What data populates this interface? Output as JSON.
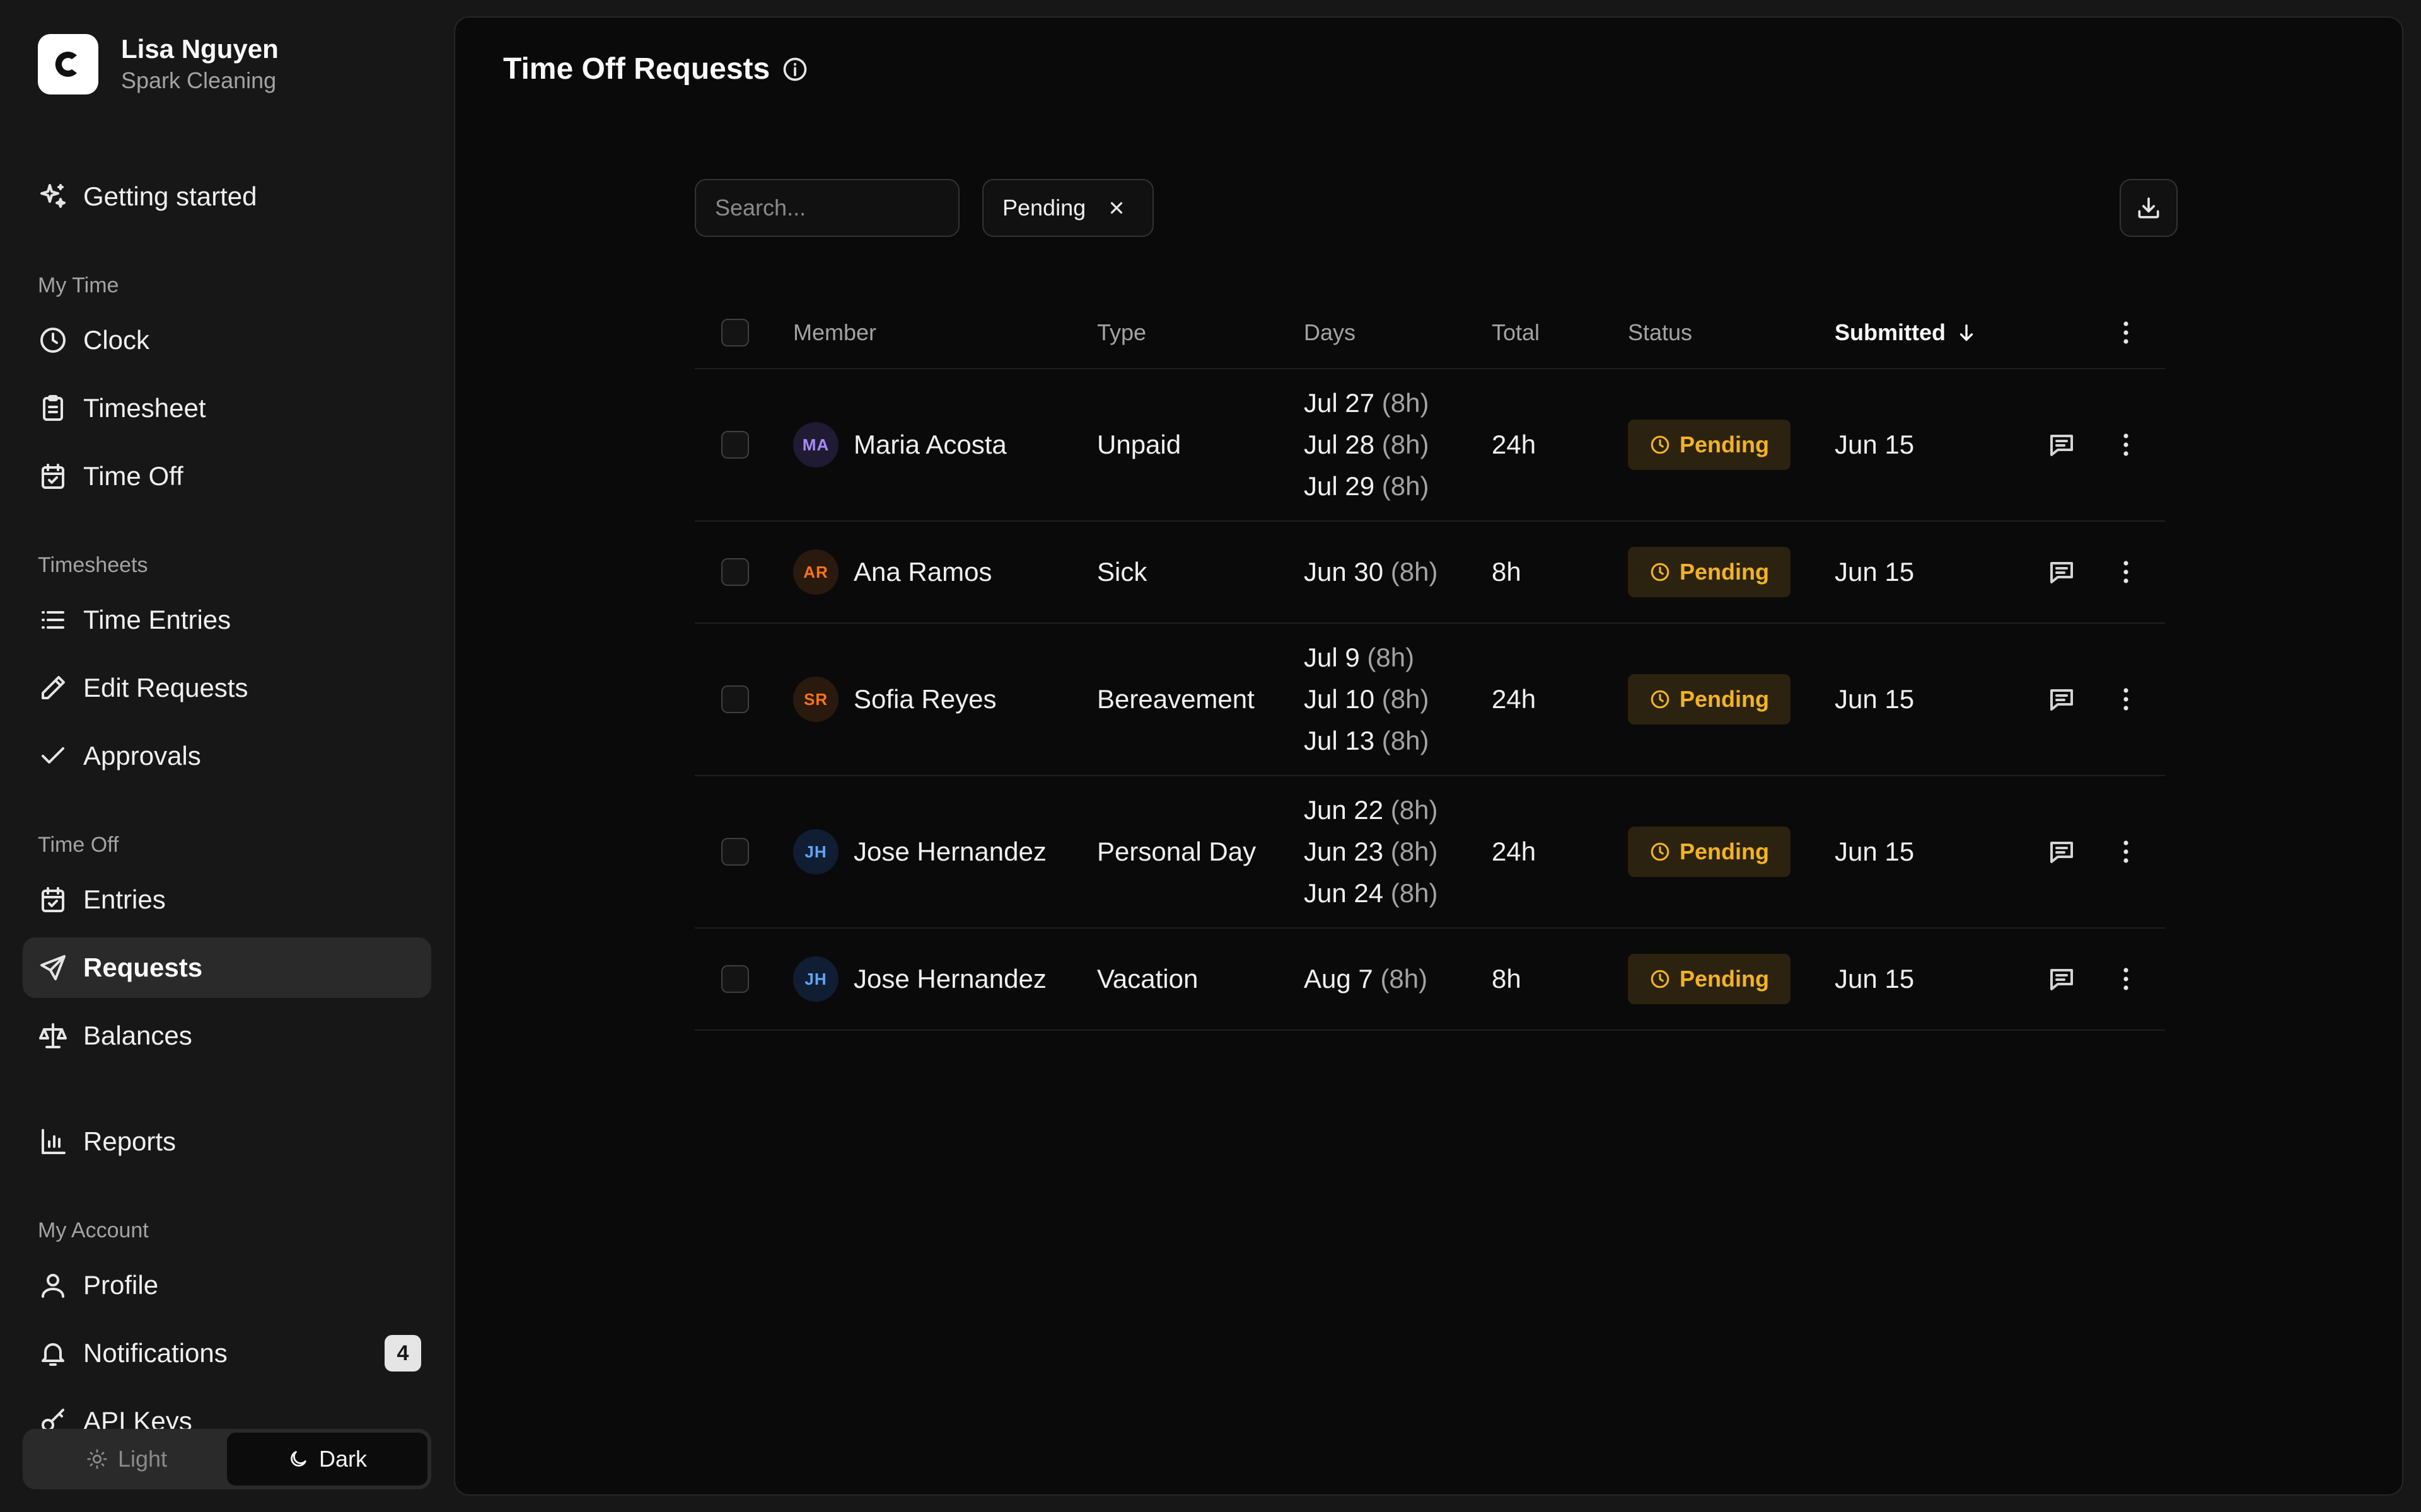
{
  "user": {
    "name": "Lisa Nguyen",
    "org": "Spark Cleaning"
  },
  "nav": {
    "getting_started": "Getting started",
    "my_time": {
      "label": "My Time",
      "items": [
        "Clock",
        "Timesheet",
        "Time Off"
      ]
    },
    "timesheets": {
      "label": "Timesheets",
      "items": [
        "Time Entries",
        "Edit Requests",
        "Approvals"
      ]
    },
    "time_off": {
      "label": "Time Off",
      "items": [
        "Entries",
        "Requests",
        "Balances"
      ]
    },
    "reports": "Reports",
    "my_account": {
      "label": "My Account",
      "items": [
        "Profile",
        "Notifications",
        "API Keys"
      ]
    },
    "notifications_count": "4",
    "active": "Requests"
  },
  "theme": {
    "light": "Light",
    "dark": "Dark",
    "active": "Dark"
  },
  "page": {
    "title": "Time Off Requests"
  },
  "toolbar": {
    "search_placeholder": "Search...",
    "filter_chip": "Pending"
  },
  "table": {
    "headers": {
      "member": "Member",
      "type": "Type",
      "days": "Days",
      "total": "Total",
      "status": "Status",
      "submitted": "Submitted"
    },
    "rows": [
      {
        "initials": "MA",
        "member": "Maria Acosta",
        "avatar_bg": "#211a33",
        "avatar_fg": "#a78bfa",
        "type": "Unpaid",
        "days": [
          {
            "date": "Jul 27",
            "hours": "(8h)"
          },
          {
            "date": "Jul 28",
            "hours": "(8h)"
          },
          {
            "date": "Jul 29",
            "hours": "(8h)"
          }
        ],
        "total": "24h",
        "status": "Pending",
        "submitted": "Jun 15"
      },
      {
        "initials": "AR",
        "member": "Ana Ramos",
        "avatar_bg": "#2a1a0e",
        "avatar_fg": "#f97316",
        "type": "Sick",
        "days": [
          {
            "date": "Jun 30",
            "hours": "(8h)"
          }
        ],
        "total": "8h",
        "status": "Pending",
        "submitted": "Jun 15"
      },
      {
        "initials": "SR",
        "member": "Sofia Reyes",
        "avatar_bg": "#2a1a0e",
        "avatar_fg": "#f97316",
        "type": "Bereavement",
        "days": [
          {
            "date": "Jul 9",
            "hours": "(8h)"
          },
          {
            "date": "Jul 10",
            "hours": "(8h)"
          },
          {
            "date": "Jul 13",
            "hours": "(8h)"
          }
        ],
        "total": "24h",
        "status": "Pending",
        "submitted": "Jun 15"
      },
      {
        "initials": "JH",
        "member": "Jose Hernandez",
        "avatar_bg": "#101e33",
        "avatar_fg": "#60a5fa",
        "type": "Personal Day",
        "days": [
          {
            "date": "Jun 22",
            "hours": "(8h)"
          },
          {
            "date": "Jun 23",
            "hours": "(8h)"
          },
          {
            "date": "Jun 24",
            "hours": "(8h)"
          }
        ],
        "total": "24h",
        "status": "Pending",
        "submitted": "Jun 15"
      },
      {
        "initials": "JH",
        "member": "Jose Hernandez",
        "avatar_bg": "#101e33",
        "avatar_fg": "#60a5fa",
        "type": "Vacation",
        "days": [
          {
            "date": "Aug 7",
            "hours": "(8h)"
          }
        ],
        "total": "8h",
        "status": "Pending",
        "submitted": "Jun 15"
      }
    ]
  },
  "colors": {
    "background": "#171717",
    "panel": "#0a0a0a",
    "status_pending": "#f5b320",
    "status_pending_bg": "#2b2310"
  }
}
